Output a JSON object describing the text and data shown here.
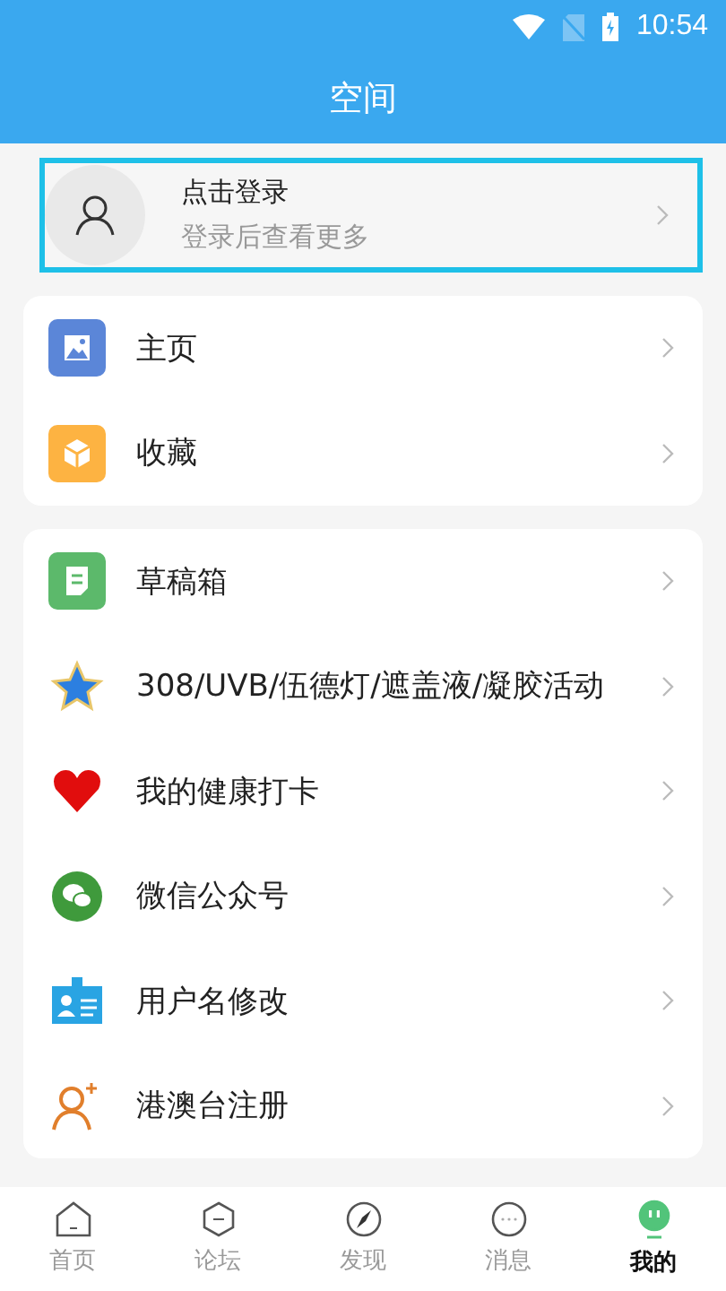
{
  "status_bar": {
    "time": "10:54"
  },
  "header": {
    "title": "空间"
  },
  "login": {
    "title": "点击登录",
    "subtitle": "登录后查看更多",
    "highlighted": true
  },
  "menu_groups": [
    {
      "items": [
        {
          "label": "主页"
        },
        {
          "label": "收藏"
        }
      ]
    },
    {
      "items": [
        {
          "label": "草稿箱"
        },
        {
          "label": "308/UVB/伍德灯/遮盖液/凝胶活动"
        },
        {
          "label": "我的健康打卡"
        },
        {
          "label": "微信公众号"
        },
        {
          "label": "用户名修改"
        },
        {
          "label": "港澳台注册"
        }
      ]
    }
  ],
  "tab_bar": [
    {
      "label": "首页",
      "selected": false
    },
    {
      "label": "论坛",
      "selected": false
    },
    {
      "label": "发现",
      "selected": false
    },
    {
      "label": "消息",
      "selected": false
    },
    {
      "label": "我的",
      "selected": true
    }
  ]
}
